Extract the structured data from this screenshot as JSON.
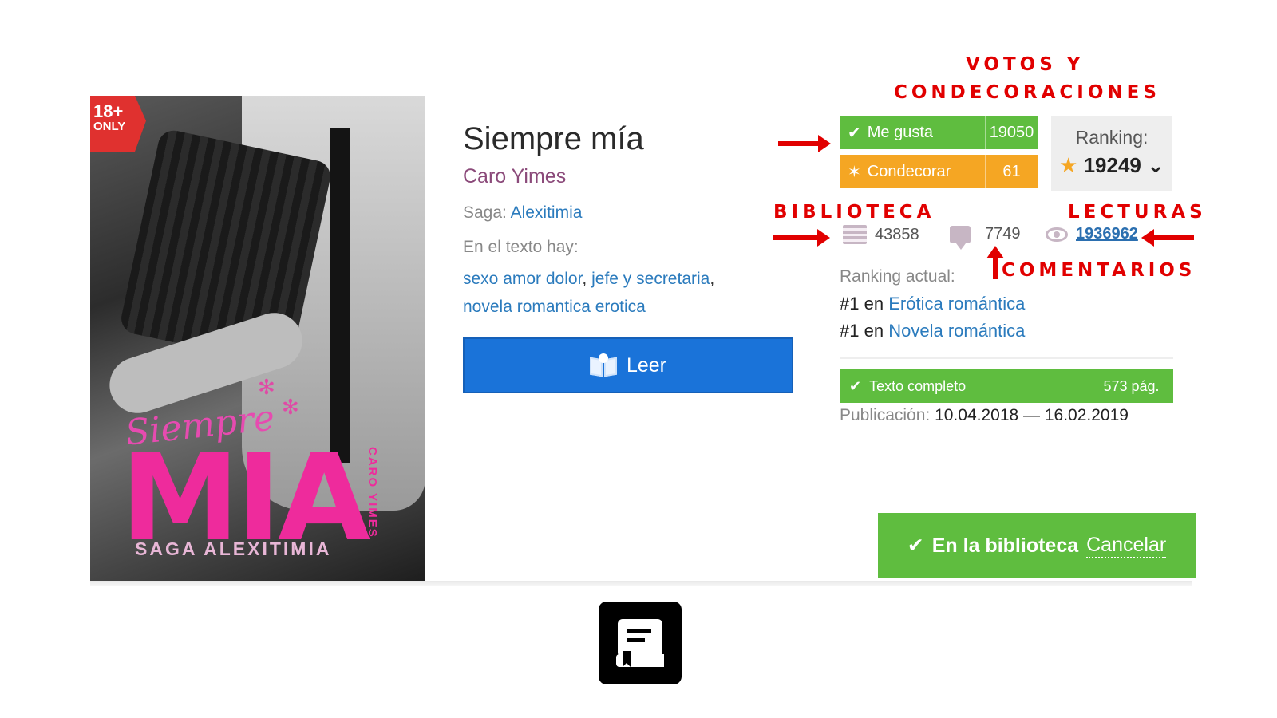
{
  "cover": {
    "badge_line1": "18+",
    "badge_line2": "ONLY",
    "script_title": "Siempre",
    "big_title": "MIA",
    "author_vertical": "CARO YIMES",
    "saga_text": "SAGA ALEXITIMIA"
  },
  "book": {
    "title": "Siempre mía",
    "author": "Caro Yimes",
    "saga_label": "Saga:",
    "saga_name": "Alexitimia",
    "tags_label": "En el texto hay:",
    "tags": [
      "sexo amor dolor",
      "jefe y secretaria",
      "novela romantica erotica"
    ],
    "tag_separator": ",",
    "read_button": "Leer"
  },
  "annotations": {
    "votes_line1": "VOTOS Y",
    "votes_line2": "CONDECORACIONES",
    "library": "BIBLIOTECA",
    "reads": "LECTURAS",
    "comments": "COMENTARIOS"
  },
  "votes": {
    "like_label": "Me gusta",
    "like_count": "19050",
    "decorate_label": "Condecorar",
    "decorate_count": "61"
  },
  "ranking": {
    "label": "Ranking:",
    "star": "★",
    "value": "19249",
    "chevron": "⌄"
  },
  "stats": {
    "library_count": "43858",
    "comments_count": "7749",
    "reads_count": "1936962"
  },
  "current_ranking": {
    "label": "Ranking actual:",
    "items": [
      {
        "position": "#1",
        "prep": "en",
        "category": "Erótica romántica"
      },
      {
        "position": "#1",
        "prep": "en",
        "category": "Novela romántica"
      }
    ]
  },
  "status": {
    "complete_label": "Texto completo",
    "pages": "573 pág.",
    "publication_label": "Publicación:",
    "publication_dates": "10.04.2018 — 16.02.2019"
  },
  "library_button": {
    "check": "✔",
    "in_label": "En la biblioteca",
    "cancel_label": "Cancelar"
  },
  "colors": {
    "green": "#5fbd3f",
    "orange": "#f5a623",
    "blue_button": "#1a73d9",
    "link": "#2b7bbd",
    "annotation_red": "#e10000",
    "author": "#8b4a7a"
  },
  "icons": {
    "check": "✔",
    "stars": "✶"
  }
}
